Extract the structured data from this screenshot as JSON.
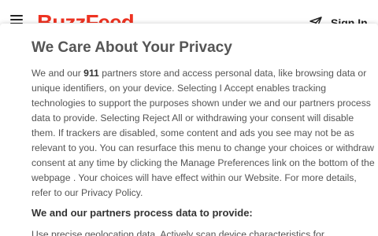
{
  "site_header": {
    "brand": "BuzzFeed",
    "signin_label": "Sign In",
    "accent_color": "#ee3322"
  },
  "dialog": {
    "title": "We Care About Your Privacy",
    "body": {
      "intro": "We and our ",
      "partner_count": "911",
      "part1": " partners store and access personal data, like browsing data or unique identifiers, on your device. Selecting I Accept enables tracking technologies to support the purposes shown under we and our partners process data to provide. Selecting Reject All or withdrawing your consent will disable them. If trackers are disabled, some content and ads you see may not be as relevant to you. You can resurface this menu to change your choices or withdraw consent at any time by clicking the Manage Preferences link on the bottom of the webpage . Your choices will have effect within our Website. For more details, refer to our ",
      "privacy_link": "Privacy Policy",
      "end": "."
    },
    "purposes_heading": "We and our partners process data to provide:",
    "purposes_text": "Use precise geolocation data. Actively scan device characteristics for"
  }
}
